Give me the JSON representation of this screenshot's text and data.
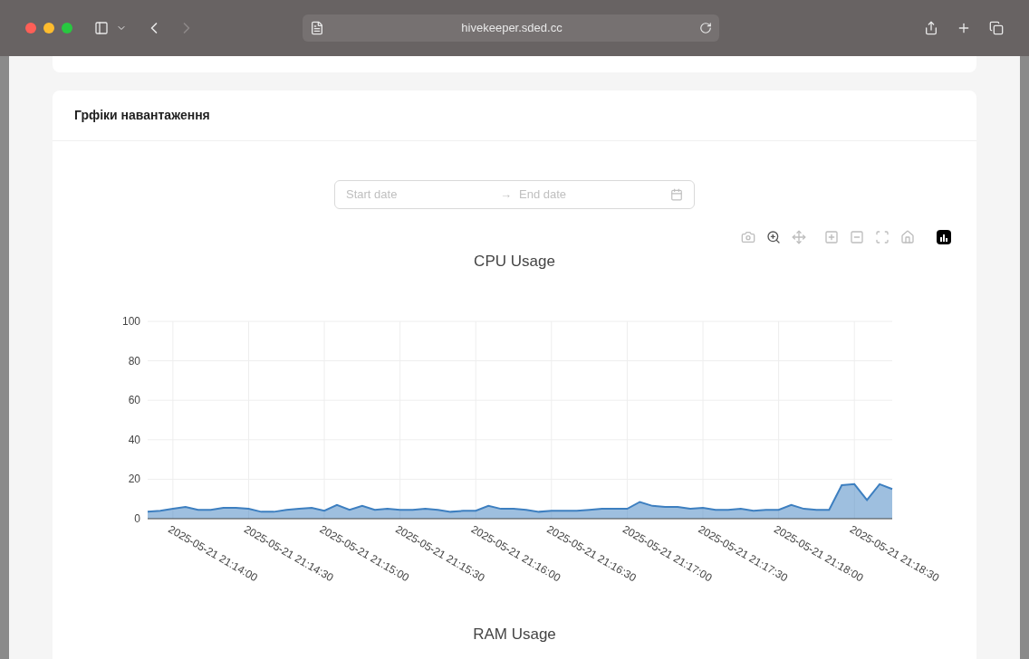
{
  "browser": {
    "address": "hivekeeper.sded.cc"
  },
  "card": {
    "title": "Грфіки навантаження"
  },
  "date_range": {
    "start_placeholder": "Start date",
    "separator": "→",
    "end_placeholder": "End date"
  },
  "charts": [
    {
      "title": "CPU Usage",
      "chart_data": {
        "type": "area",
        "categories": [
          null,
          null,
          "2025-05-21 21:14:00",
          null,
          null,
          null,
          null,
          null,
          "2025-05-21 21:14:30",
          null,
          null,
          null,
          null,
          null,
          "2025-05-21 21:15:00",
          null,
          null,
          null,
          null,
          null,
          "2025-05-21 21:15:30",
          null,
          null,
          null,
          null,
          null,
          "2025-05-21 21:16:00",
          null,
          null,
          null,
          null,
          null,
          "2025-05-21 21:16:30",
          null,
          null,
          null,
          null,
          null,
          "2025-05-21 21:17:00",
          null,
          null,
          null,
          null,
          null,
          "2025-05-21 21:17:30",
          null,
          null,
          null,
          null,
          null,
          "2025-05-21 21:18:00",
          null,
          null,
          null,
          null,
          null,
          "2025-05-21 21:18:30",
          null,
          null,
          null
        ],
        "series": [
          {
            "color": "#3d7fc0",
            "values": [
              3.5,
              4,
              5,
              6,
              4.5,
              4.5,
              5.5,
              5.5,
              5,
              3.5,
              3.5,
              4.5,
              5,
              5.5,
              4,
              7,
              4.5,
              6.5,
              4.5,
              5,
              4.5,
              4.5,
              5,
              4.5,
              3.5,
              4,
              4,
              6.5,
              5,
              5,
              4.5,
              3.5,
              4,
              4,
              4,
              4.5,
              5,
              5,
              5,
              8.5,
              6.5,
              6,
              6,
              5,
              5.5,
              4.5,
              4.5,
              5,
              4,
              4.5,
              4.5,
              7,
              5,
              4.5,
              4.5,
              17,
              17.5,
              9.5,
              17.5,
              15
            ]
          }
        ],
        "grid": true,
        "ylim": [
          0,
          100
        ],
        "yticks": [
          0,
          20,
          40,
          60,
          80,
          100
        ]
      }
    },
    {
      "title": "RAM Usage"
    }
  ]
}
